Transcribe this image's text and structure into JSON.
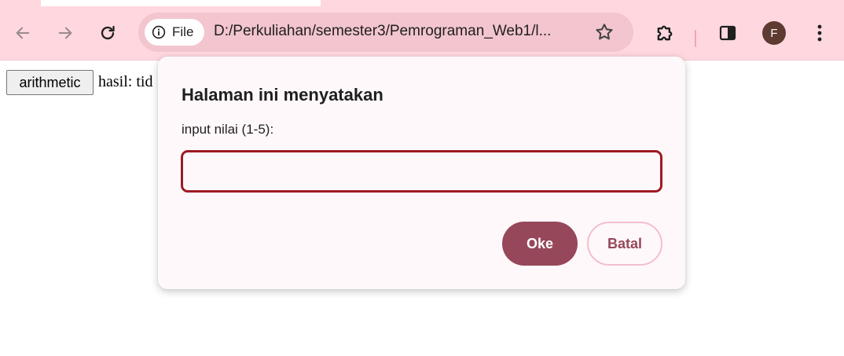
{
  "browser": {
    "back_icon": "arrow-left-icon",
    "forward_icon": "arrow-right-icon",
    "reload_icon": "reload-icon",
    "site_info_icon": "info-icon",
    "site_info_label": "File",
    "url": "D:/Perkuliahan/semester3/Pemrograman_Web1/l...",
    "bookmark_icon": "star-icon",
    "extensions_icon": "puzzle-icon",
    "side_panel_icon": "side-panel-icon",
    "profile_initial": "F",
    "menu_icon": "kebab-menu-icon",
    "colors": {
      "toolbar": "#ffd7df",
      "omnibox": "#f3c5ce",
      "avatar": "#5d3b31"
    }
  },
  "page": {
    "button_label": "arithmetic",
    "result_text": "hasil: tid"
  },
  "dialog": {
    "title": "Halaman ini menyatakan",
    "message": "input nilai (1-5):",
    "input_value": "",
    "ok_label": "Oke",
    "cancel_label": "Batal",
    "colors": {
      "accent": "#96475a",
      "input_border": "#9c1a24",
      "background": "#fff8fb"
    }
  }
}
